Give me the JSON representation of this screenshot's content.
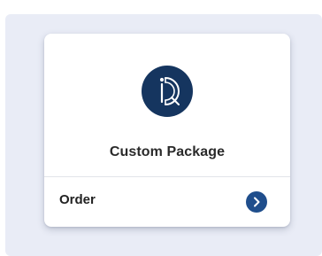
{
  "card": {
    "title": "Custom Package",
    "action_label": "Order",
    "logo_icon": "brand-logo-icon",
    "action_icon": "chevron-right-icon"
  },
  "colors": {
    "background_panel": "#e9ecf6",
    "card": "#ffffff",
    "logo_circle": "#15355f",
    "action_button": "#1f4e8c",
    "text": "#2a2a2a"
  }
}
